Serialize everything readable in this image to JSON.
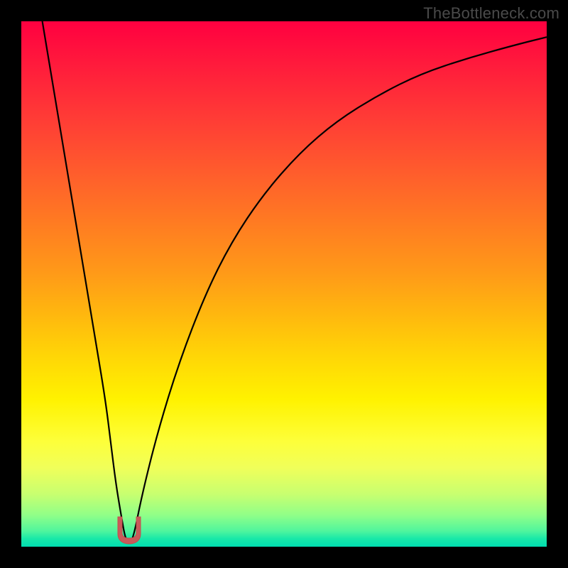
{
  "watermark": "TheBottleneck.com",
  "chart_data": {
    "type": "line",
    "title": "",
    "xlabel": "",
    "ylabel": "",
    "ylim": [
      0,
      100
    ],
    "xlim": [
      0,
      100
    ],
    "series": [
      {
        "name": "bottleneck-curve",
        "x": [
          4,
          6,
          8,
          10,
          12,
          14,
          16,
          17,
          18,
          19,
          19.8,
          20.5,
          21.3,
          23,
          26,
          30,
          35,
          40,
          46,
          53,
          60,
          68,
          76,
          85,
          94,
          100
        ],
        "values": [
          100,
          88,
          76,
          64,
          52,
          40,
          28,
          20,
          12,
          6,
          1.5,
          0.8,
          1.5,
          10,
          22,
          35,
          48,
          58,
          67,
          75,
          81,
          86,
          90,
          93,
          95.5,
          97
        ]
      }
    ],
    "optimum": {
      "x": 20.5,
      "value": 0.8
    },
    "colors": {
      "curve": "#000000",
      "marker": "#c95a5a",
      "top": "#ff0040",
      "mid": "#ffd800",
      "bottom": "#00dcb0"
    }
  }
}
